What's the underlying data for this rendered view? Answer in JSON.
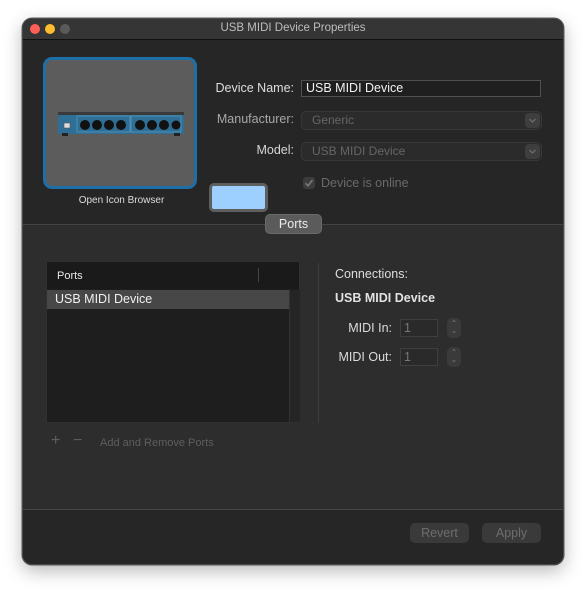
{
  "window": {
    "title": "USB MIDI Device Properties",
    "traffic_lights": {
      "close_color": "#fe5f57",
      "minimize_color": "#febc2e",
      "zoom_color": "#5a5a5a"
    }
  },
  "device": {
    "icon_name": "midi-interface-device-icon",
    "icon_caption": "Open Icon Browser",
    "name_label": "Device Name:",
    "name_value": "USB MIDI Device",
    "manufacturer_label": "Manufacturer:",
    "manufacturer_value": "Generic",
    "model_label": "Model:",
    "model_value": "USB MIDI Device",
    "color_well_color": "#9dd0ff",
    "online_label": "Device is online",
    "online_checked": true
  },
  "section": {
    "label": "Ports"
  },
  "ports": {
    "column_header": "Ports",
    "items": [
      {
        "name": "USB MIDI Device",
        "selected": true
      }
    ],
    "add_icon": "+",
    "remove_icon": "−",
    "add_remove_label": "Add and Remove Ports"
  },
  "connections": {
    "title": "Connections:",
    "device_name": "USB MIDI Device",
    "midi_in_label": "MIDI In:",
    "midi_in_value": "1",
    "midi_out_label": "MIDI Out:",
    "midi_out_value": "1",
    "stepper_up": "⌃",
    "stepper_down": "⌄"
  },
  "footer": {
    "revert_label": "Revert",
    "apply_label": "Apply"
  }
}
